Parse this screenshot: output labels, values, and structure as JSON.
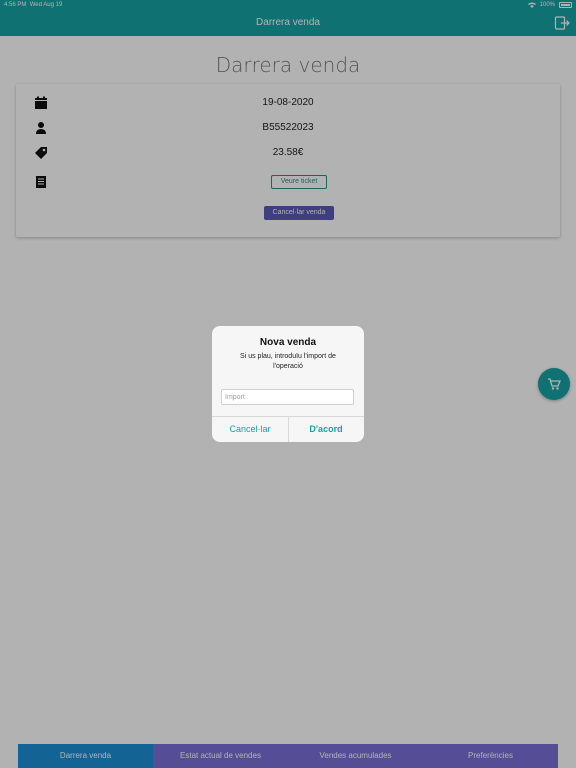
{
  "status_bar": {
    "time": "4:56 PM",
    "date": "Wed Aug 19",
    "battery": "100%"
  },
  "header": {
    "title": "Darrera venda",
    "logout_icon": "logout-icon"
  },
  "page_title": "Darrera venda",
  "last_sale": {
    "date": "19-08-2020",
    "user": "B55522023",
    "amount": "23.58€",
    "ticket_button": "Veure ticket",
    "cancel_button": "Cancel·lar venda"
  },
  "fab": {
    "icon": "cart-icon"
  },
  "tabs": [
    {
      "label": "Darrera venda",
      "active": true
    },
    {
      "label": "Estat actual de vendes",
      "active": false
    },
    {
      "label": "Vendes acumulades",
      "active": false
    },
    {
      "label": "Preferències",
      "active": false
    }
  ],
  "dialog": {
    "title": "Nova venda",
    "message": "Si us plau, introduïu l'import de l'operació",
    "input_placeholder": "Import",
    "input_value": "",
    "cancel_label": "Cancel·lar",
    "ok_label": "D'acord"
  },
  "colors": {
    "primary": "#17a2a5",
    "tab_active": "#1c8fd6",
    "tab_inactive": "#7a6fd6",
    "cancel_button": "#5b59b6"
  }
}
